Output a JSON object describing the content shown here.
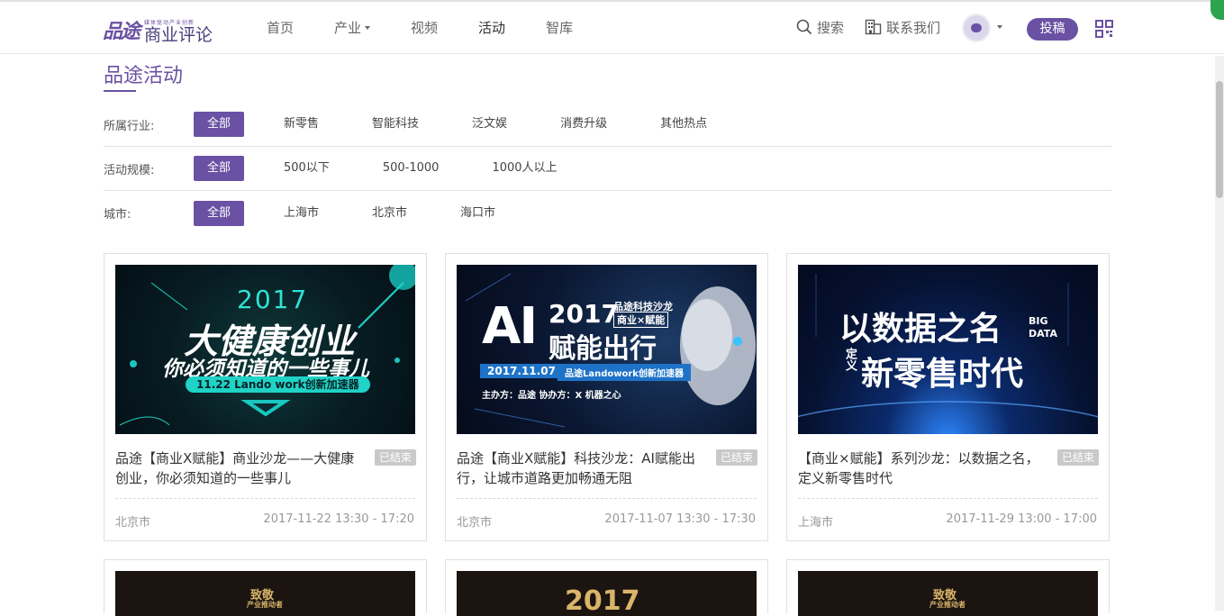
{
  "header": {
    "logo_script": "品途",
    "logo_tagline": "媒体驱动产业创新",
    "logo_text": "商业评论",
    "nav": [
      {
        "label": "首页"
      },
      {
        "label": "产业"
      },
      {
        "label": "视频"
      },
      {
        "label": "活动"
      },
      {
        "label": "智库"
      }
    ],
    "search_label": "搜索",
    "contact_label": "联系我们",
    "submit_label": "投稿"
  },
  "page": {
    "title": "品途活动"
  },
  "filters": {
    "industry": {
      "label": "所属行业:",
      "options": [
        "全部",
        "新零售",
        "智能科技",
        "泛文娱",
        "消费升级",
        "其他热点"
      ]
    },
    "scale": {
      "label": "活动规模:",
      "options": [
        "全部",
        "500以下",
        "500-1000",
        "1000人以上"
      ]
    },
    "city": {
      "label": "城市:",
      "options": [
        "全部",
        "上海市",
        "北京市",
        "海口市"
      ]
    }
  },
  "events": [
    {
      "title": "品途【商业X赋能】商业沙龙——大健康创业，你必须知道的一些事儿",
      "status": "已结束",
      "city": "北京市",
      "time": "2017-11-22 13:30 - 17:20",
      "poster": {
        "year": "2017",
        "headline": "大健康创业",
        "subline": "你必须知道的一些事儿",
        "pill": "11.22 Lando work创新加速器"
      }
    },
    {
      "title": "品途【商业X赋能】科技沙龙：AI赋能出行，让城市道路更加畅通无阻",
      "status": "已结束",
      "city": "北京市",
      "time": "2017-11-07 13:30 - 17:30",
      "poster": {
        "ai": "AI",
        "year": "2017",
        "headline": "赋能出行",
        "tag": "品途科技沙龙",
        "tag2": "商业×赋能",
        "date": "2017.11.07",
        "venue": "品途Landowork创新加速器",
        "host": "主办方：品途   协办方：X 机器之心"
      }
    },
    {
      "title": "【商业×赋能】系列沙龙：以数据之名，定义新零售时代",
      "status": "已结束",
      "city": "上海市",
      "time": "2017-11-29 13:00 - 17:00",
      "poster": {
        "line1": "以数据之名",
        "line2": "新零售时代",
        "side": "定义",
        "tag1": "BIG",
        "tag2": "DATA"
      }
    }
  ],
  "next_row_posters": [
    {
      "text": "致敬",
      "sub": "产业推动者"
    },
    {
      "text": "2017"
    },
    {
      "text": "致敬",
      "sub": "产业推动者"
    }
  ],
  "colors": {
    "accent": "#6a51a3",
    "badge": "#c9c9c9"
  }
}
